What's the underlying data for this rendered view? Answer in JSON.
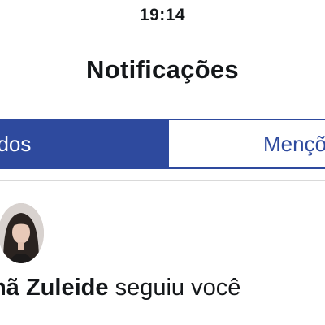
{
  "status_bar": {
    "time": "19:14"
  },
  "header": {
    "title": "Notificações"
  },
  "tabs": [
    {
      "label": "Todos",
      "visible_text": "odos",
      "active": true
    },
    {
      "label": "Menções",
      "visible_text": "Mençõ",
      "active": false
    }
  ],
  "notifications": [
    {
      "user_visible": "mã Zuleide",
      "action": "seguiu você",
      "avatar_icon": "user-avatar"
    }
  ],
  "colors": {
    "accent": "#2e4a9e",
    "text": "#14171a",
    "divider": "#d9d9d9"
  }
}
